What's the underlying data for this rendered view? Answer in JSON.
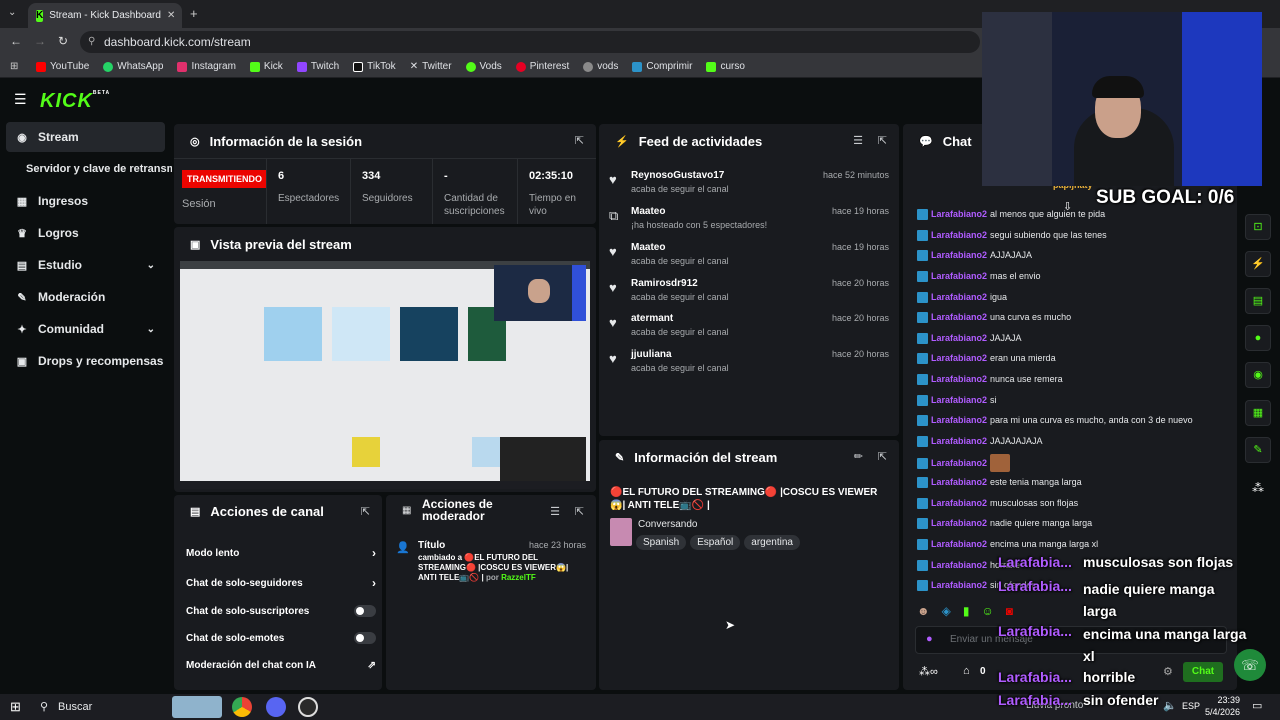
{
  "browser": {
    "tab_title": "Stream - Kick Dashboard",
    "url": "dashboard.kick.com/stream",
    "bookmarks": [
      {
        "label": "YouTube",
        "color": "#ff0000"
      },
      {
        "label": "WhatsApp",
        "color": "#25d366"
      },
      {
        "label": "Instagram",
        "color": "#e1306c"
      },
      {
        "label": "Kick",
        "color": "#53fc18"
      },
      {
        "label": "Twitch",
        "color": "#9146ff"
      },
      {
        "label": "TikTok",
        "color": "#ffffff"
      },
      {
        "label": "Twitter",
        "color": "#ffffff"
      },
      {
        "label": "Vods",
        "color": "#53fc18"
      },
      {
        "label": "Pinterest",
        "color": "#e60023"
      },
      {
        "label": "vods",
        "color": "#8a8a8a"
      },
      {
        "label": "Comprimir",
        "color": "#2c93c9"
      },
      {
        "label": "curso",
        "color": "#53fc18"
      }
    ]
  },
  "logo": {
    "text": "KICK",
    "beta": "BETA"
  },
  "sidebar": {
    "items": [
      {
        "label": "Stream",
        "icon": "broadcast-icon"
      },
      {
        "label": "Servidor y clave de retransmisión",
        "icon": ""
      },
      {
        "label": "Ingresos",
        "icon": "money-icon"
      },
      {
        "label": "Logros",
        "icon": "trophy-icon"
      },
      {
        "label": "Estudio",
        "icon": "studio-icon"
      },
      {
        "label": "Moderación",
        "icon": "wrench-icon"
      },
      {
        "label": "Comunidad",
        "icon": "community-icon"
      },
      {
        "label": "Drops y recompensas",
        "icon": "drops-icon"
      }
    ]
  },
  "session": {
    "title": "Información de la sesión",
    "badge": "TRANSMITIENDO",
    "status_label": "Sesión",
    "viewers": "6",
    "viewers_label": "Espectadores",
    "followers": "334",
    "followers_label": "Seguidores",
    "subs": "-",
    "subs_label": "Cantidad de suscripciones",
    "time": "02:35:10",
    "time_label": "Tiempo en vivo"
  },
  "preview": {
    "title": "Vista previa del stream"
  },
  "feed": {
    "title": "Feed de actividades",
    "items": [
      {
        "name": "ReynosoGustavo17",
        "sub": "acaba de seguir el canal",
        "time": "hace 52 minutos",
        "icon": "heart"
      },
      {
        "name": "Maateo",
        "sub": "¡ha hosteado con 5 espectadores!",
        "time": "hace 19 horas",
        "icon": "host"
      },
      {
        "name": "Maateo",
        "sub": "acaba de seguir el canal",
        "time": "hace 19 horas",
        "icon": "heart"
      },
      {
        "name": "Ramirosdr912",
        "sub": "acaba de seguir el canal",
        "time": "hace 20 horas",
        "icon": "heart"
      },
      {
        "name": "atermant",
        "sub": "acaba de seguir el canal",
        "time": "hace 20 horas",
        "icon": "heart"
      },
      {
        "name": "jjuuliana",
        "sub": "acaba de seguir el canal",
        "time": "hace 20 horas",
        "icon": "heart"
      }
    ]
  },
  "stream_info": {
    "title": "Información del stream",
    "stream_title": "🔴EL FUTURO DEL STREAMING🔴 |COSCU ES VIEWER😱| ANTI TELE📺🚫 |",
    "category": "Conversando",
    "tags": [
      "Spanish",
      "Español",
      "argentina"
    ]
  },
  "channel_actions": {
    "title": "Acciones de canal",
    "items": [
      {
        "label": "Modo lento",
        "control": "arrow"
      },
      {
        "label": "Chat de solo-seguidores",
        "control": "arrow"
      },
      {
        "label": "Chat de solo-suscriptores",
        "control": "toggle"
      },
      {
        "label": "Chat de solo-emotes",
        "control": "toggle"
      },
      {
        "label": "Moderación del chat con IA",
        "control": "external"
      }
    ]
  },
  "mod_actions": {
    "title": "Acciones de moderador",
    "entry_title": "Título",
    "entry_time": "hace 23 horas",
    "entry_text": "cambiado a 🔴EL FUTURO DEL STREAMING🔴 |COSCU ES VIEWER😱| ANTI TELE📺🚫 |",
    "entry_by_prefix": "por",
    "entry_by": "RazzelTF"
  },
  "chat": {
    "title": "Chat",
    "pinned_user": "papijnaty",
    "messages": [
      {
        "user": "Larafabiano2",
        "text": "al menos que alguien te pida"
      },
      {
        "user": "Larafabiano2",
        "text": "segui subiendo que las tenes"
      },
      {
        "user": "Larafabiano2",
        "text": "AJJAJAJA"
      },
      {
        "user": "Larafabiano2",
        "text": "mas el envio"
      },
      {
        "user": "Larafabiano2",
        "text": "igua"
      },
      {
        "user": "Larafabiano2",
        "text": "una curva es mucho"
      },
      {
        "user": "Larafabiano2",
        "text": "JAJAJA"
      },
      {
        "user": "Larafabiano2",
        "text": "eran una mierda"
      },
      {
        "user": "Larafabiano2",
        "text": "nunca use remera"
      },
      {
        "user": "Larafabiano2",
        "text": "si"
      },
      {
        "user": "Larafabiano2",
        "text": "para mi una curva es mucho, anda con 3 de nuevo"
      },
      {
        "user": "Larafabiano2",
        "text": "JAJAJAJAJA"
      },
      {
        "user": "Larafabiano2",
        "text": ""
      },
      {
        "user": "Larafabiano2",
        "text": "este tenia manga larga"
      },
      {
        "user": "Larafabiano2",
        "text": "musculosas son flojas"
      },
      {
        "user": "Larafabiano2",
        "text": "nadie quiere manga larga"
      },
      {
        "user": "Larafabiano2",
        "text": "encima una manga larga xl"
      },
      {
        "user": "Larafabiano2",
        "text": "horrible"
      },
      {
        "user": "Larafabiano2",
        "text": "sin ofender"
      }
    ],
    "input_placeholder": "Enviar un mensaje",
    "send_label": "Chat",
    "points": "0"
  },
  "overlay": {
    "sub_goal": "SUB GOAL: 0/6",
    "messages": [
      {
        "user": "Larafabia...",
        "text": "musculosas son flojas"
      },
      {
        "user": "Larafabia...",
        "text": "nadie quiere manga larga"
      },
      {
        "user": "Larafabia...",
        "text": "encima una manga larga xl"
      },
      {
        "user": "Larafabia...",
        "text": "horrible"
      },
      {
        "user": "Larafabia...",
        "text": "sin ofender"
      }
    ]
  },
  "taskbar": {
    "search": "Buscar",
    "time": "23:39",
    "date": "5/4/2026",
    "lang": "ESP",
    "weather": "Lluvia pronto"
  }
}
